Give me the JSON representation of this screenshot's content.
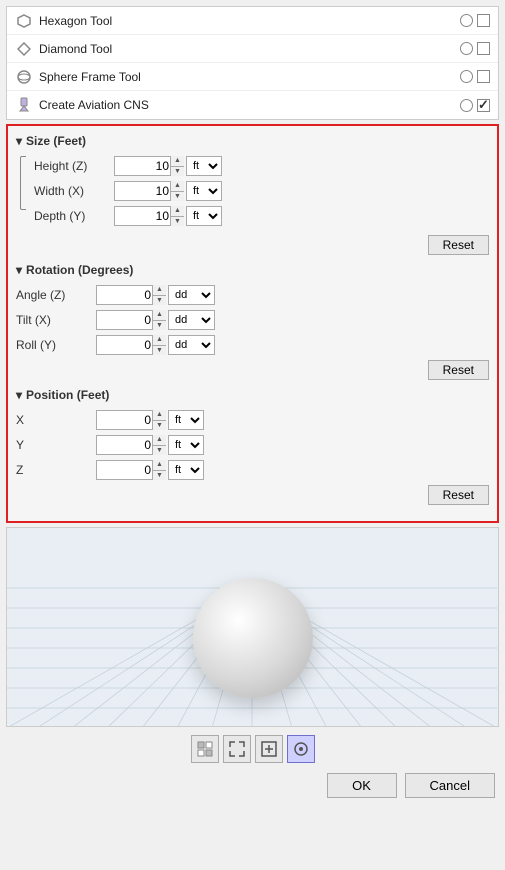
{
  "tools": [
    {
      "id": "hexagon",
      "label": "Hexagon Tool",
      "icon": "⬡",
      "radio": true,
      "checked": false
    },
    {
      "id": "diamond",
      "label": "Diamond Tool",
      "icon": "◇",
      "radio": true,
      "checked": false
    },
    {
      "id": "sphere-frame",
      "label": "Sphere Frame Tool",
      "icon": "⊕",
      "radio": true,
      "checked": false
    },
    {
      "id": "aviation-cns",
      "label": "Create Aviation CNS",
      "icon": "🔧",
      "radio": true,
      "checked": true
    }
  ],
  "sections": {
    "size": {
      "header": "▾ Size (Feet)",
      "arrow": "▾",
      "title": "Size (Feet)",
      "fields": [
        {
          "id": "height",
          "label": "Height (Z)",
          "value": "10",
          "unit": "ft"
        },
        {
          "id": "width",
          "label": "Width (X)",
          "value": "10",
          "unit": "ft"
        },
        {
          "id": "depth",
          "label": "Depth (Y)",
          "value": "10",
          "unit": "ft"
        }
      ],
      "reset_label": "Reset"
    },
    "rotation": {
      "arrow": "▾",
      "title": "Rotation (Degrees)",
      "fields": [
        {
          "id": "angle",
          "label": "Angle (Z)",
          "value": "0",
          "unit": "dd"
        },
        {
          "id": "tilt",
          "label": "Tilt (X)",
          "value": "0",
          "unit": "dd"
        },
        {
          "id": "roll",
          "label": "Roll (Y)",
          "value": "0",
          "unit": "dd"
        }
      ],
      "reset_label": "Reset"
    },
    "position": {
      "arrow": "▾",
      "title": "Position (Feet)",
      "fields": [
        {
          "id": "pos-x",
          "label": "X",
          "value": "0",
          "unit": "ft"
        },
        {
          "id": "pos-y",
          "label": "Y",
          "value": "0",
          "unit": "ft"
        },
        {
          "id": "pos-z",
          "label": "Z",
          "value": "0",
          "unit": "ft"
        }
      ],
      "reset_label": "Reset"
    }
  },
  "preview": {
    "tools": [
      {
        "id": "grid-tool",
        "icon": "⊞",
        "active": false,
        "label": "Grid"
      },
      {
        "id": "fit-tool",
        "icon": "⤢",
        "active": false,
        "label": "Fit"
      },
      {
        "id": "zoom-tool",
        "icon": "⛶",
        "active": false,
        "label": "Zoom"
      },
      {
        "id": "sphere-tool",
        "icon": "◉",
        "active": true,
        "label": "Sphere"
      }
    ]
  },
  "buttons": {
    "ok_label": "OK",
    "cancel_label": "Cancel"
  }
}
